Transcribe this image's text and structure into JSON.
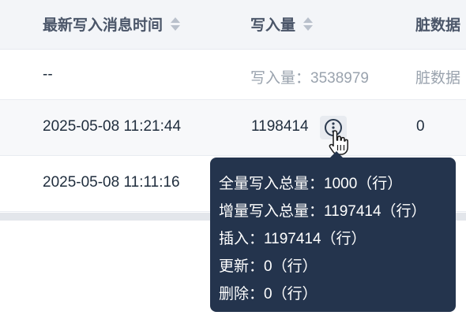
{
  "table": {
    "headers": {
      "last_message_time": "最新写入消息时间",
      "write_count": "写入量",
      "dirty_data": "脏数据"
    },
    "rows": [
      {
        "time": "--",
        "write": "写入量：3538979",
        "dirty": "脏数据"
      },
      {
        "time": "2025-05-08 11:21:44",
        "write": "1198414",
        "dirty": "0"
      },
      {
        "time": "2025-05-08 11:11:16"
      }
    ]
  },
  "tooltip": {
    "lines": [
      "全量写入总量：1000（行）",
      "增量写入总量：1197414（行）",
      "插入：1197414（行）",
      "更新：0（行）",
      "删除：0（行）"
    ]
  }
}
